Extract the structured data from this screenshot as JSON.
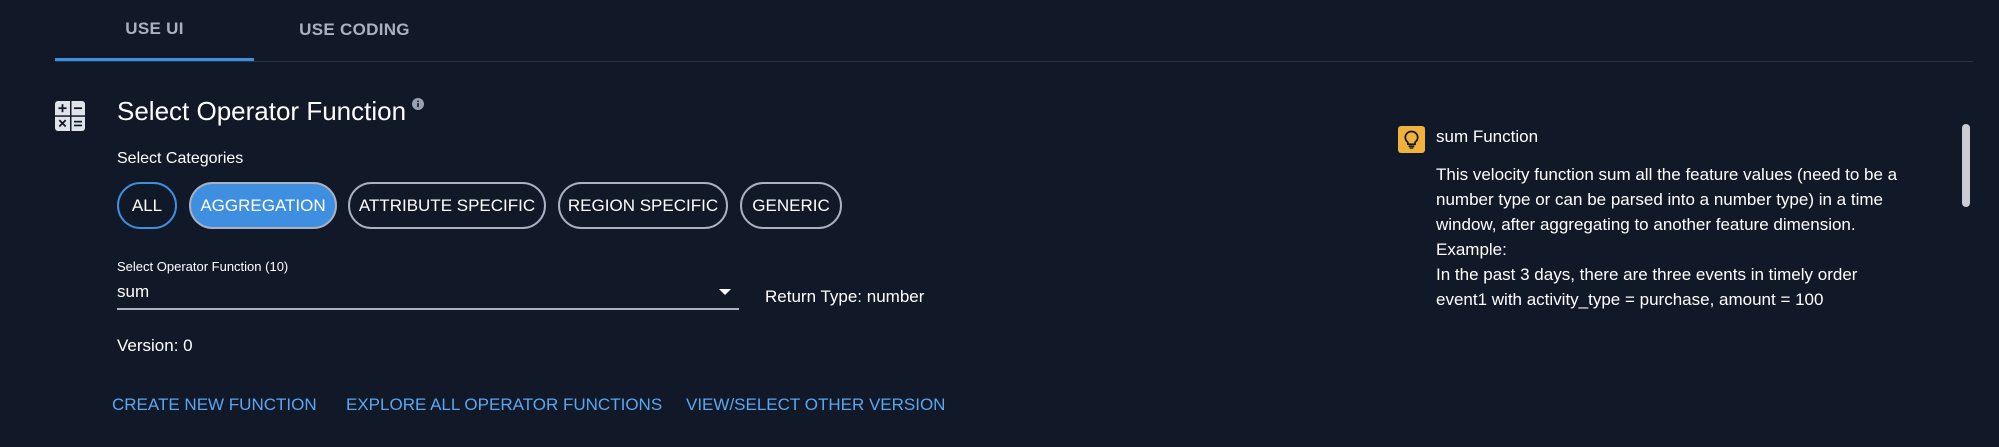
{
  "tabs": [
    {
      "label": "USE UI",
      "active": true
    },
    {
      "label": "USE CODING",
      "active": false
    }
  ],
  "section": {
    "title": "Select Operator Function",
    "icon": "calculator-icon",
    "info_icon": "info-icon"
  },
  "categories": {
    "label": "Select Categories",
    "chips": [
      {
        "label": "ALL",
        "state": "outlined-active"
      },
      {
        "label": "AGGREGATION",
        "state": "selected"
      },
      {
        "label": "ATTRIBUTE SPECIFIC",
        "state": "default"
      },
      {
        "label": "REGION SPECIFIC",
        "state": "default"
      },
      {
        "label": "GENERIC",
        "state": "default"
      }
    ]
  },
  "operator_select": {
    "label": "Select Operator Function (10)",
    "value": "sum",
    "caret_icon": "caret-down-icon"
  },
  "return_type": "Return Type: number",
  "version": "Version: 0",
  "links": {
    "create": "CREATE NEW FUNCTION",
    "explore": "EXPLORE ALL OPERATOR FUNCTIONS",
    "view": "VIEW/SELECT OTHER VERSION"
  },
  "help": {
    "icon": "lightbulb-icon",
    "title": "sum Function",
    "lines": [
      "This velocity function sum all the feature values (need to be a",
      "number type or can be parsed into a number type) in a time",
      "window, after aggregating to another feature dimension.",
      "Example:",
      "In the past 3 days, there are three events in timely order",
      "event1 with activity_type = purchase, amount = 100"
    ]
  },
  "colors": {
    "background": "#111828",
    "accent": "#3f8fe0",
    "link": "#5aa6f0",
    "chip_border": "#aab1c0",
    "bulb": "#f0b23a"
  }
}
